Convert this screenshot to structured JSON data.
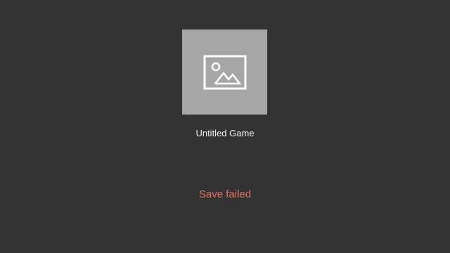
{
  "game": {
    "title": "Untitled Game",
    "thumbnail_icon": "image-placeholder-icon"
  },
  "status": {
    "message": "Save failed",
    "color": "#e8705f"
  },
  "colors": {
    "background": "#333333",
    "thumbnail": "#a6a6a6"
  }
}
